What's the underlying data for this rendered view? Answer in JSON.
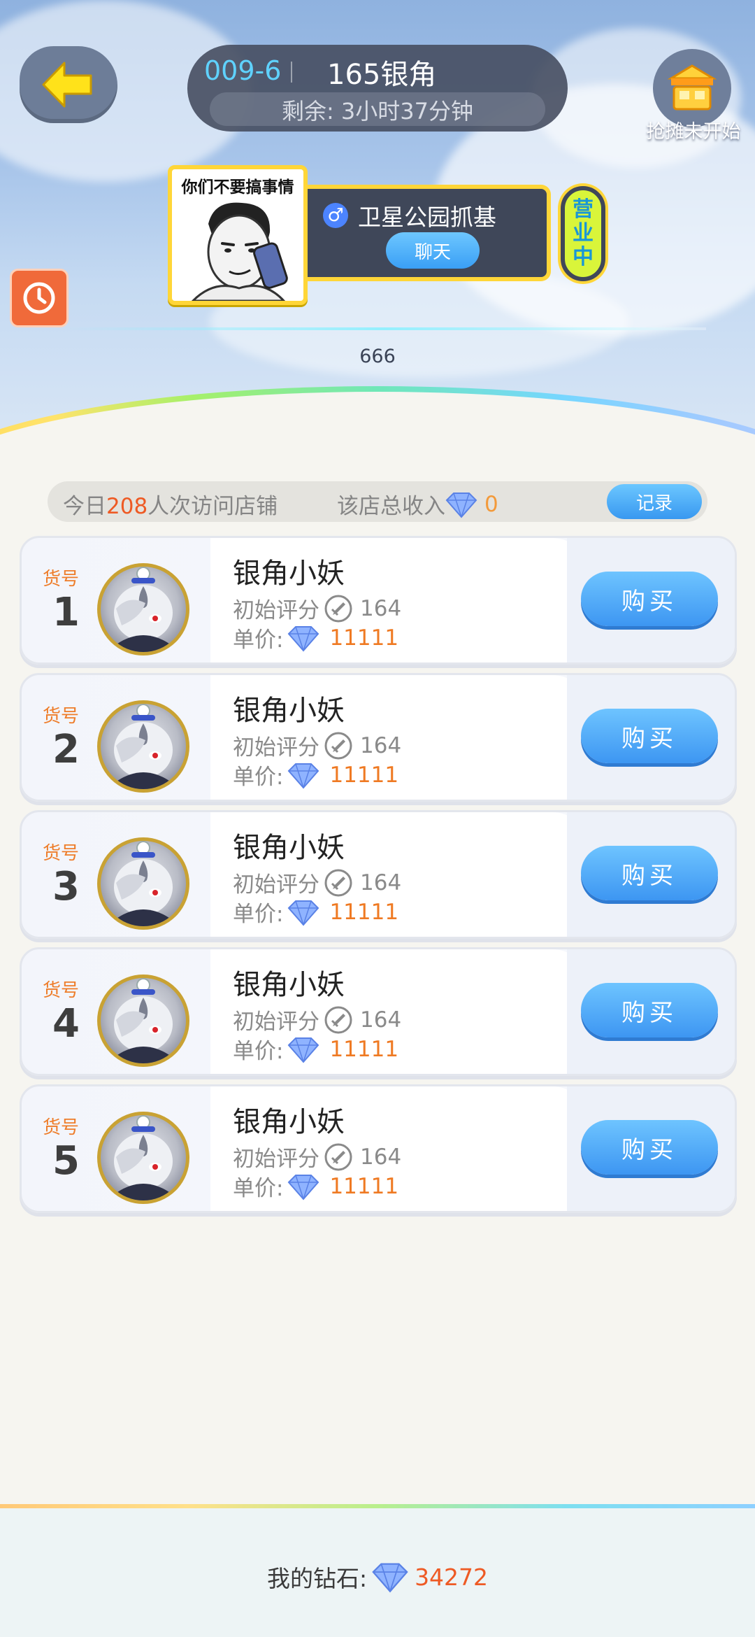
{
  "header": {
    "stall_code": "009-6",
    "stall_name": "165银角",
    "remaining": "剩余: 3小时37分钟",
    "stall_status": "抢摊未开始"
  },
  "owner": {
    "avatar_caption": "你们不要搞事情",
    "name": "卫星公园抓基",
    "chat_label": "聊天",
    "open_badge": [
      "营",
      "业",
      "中"
    ]
  },
  "sign_text": "666",
  "stats": {
    "visits_prefix": "今日",
    "visits_count": "208",
    "visits_suffix": "人次访问店铺",
    "income_label": "该店总收入",
    "income_value": "0",
    "record_label": "记录"
  },
  "items": [
    {
      "lot_label": "货号",
      "lot": "1",
      "name": "银角小妖",
      "score_label": "初始评分",
      "score": "164",
      "price_label": "单价:",
      "price": "11111",
      "buy_label": "购买"
    },
    {
      "lot_label": "货号",
      "lot": "2",
      "name": "银角小妖",
      "score_label": "初始评分",
      "score": "164",
      "price_label": "单价:",
      "price": "11111",
      "buy_label": "购买"
    },
    {
      "lot_label": "货号",
      "lot": "3",
      "name": "银角小妖",
      "score_label": "初始评分",
      "score": "164",
      "price_label": "单价:",
      "price": "11111",
      "buy_label": "购买"
    },
    {
      "lot_label": "货号",
      "lot": "4",
      "name": "银角小妖",
      "score_label": "初始评分",
      "score": "164",
      "price_label": "单价:",
      "price": "11111",
      "buy_label": "购买"
    },
    {
      "lot_label": "货号",
      "lot": "5",
      "name": "银角小妖",
      "score_label": "初始评分",
      "score": "164",
      "price_label": "单价:",
      "price": "11111",
      "buy_label": "购买"
    }
  ],
  "footer": {
    "diamonds_label": "我的钻石:",
    "diamonds_value": "34272"
  },
  "icons": {
    "back": "back-arrow-icon",
    "stall": "stall-icon",
    "gender": "male-icon",
    "clock": "clock-icon",
    "diamond": "diamond-icon",
    "sword": "sword-icon"
  },
  "colors": {
    "accent_blue": "#3d96f2",
    "highlight_orange": "#ee5a24",
    "price_orange": "#ef7a23",
    "owner_frame_yellow": "#ffd638"
  }
}
